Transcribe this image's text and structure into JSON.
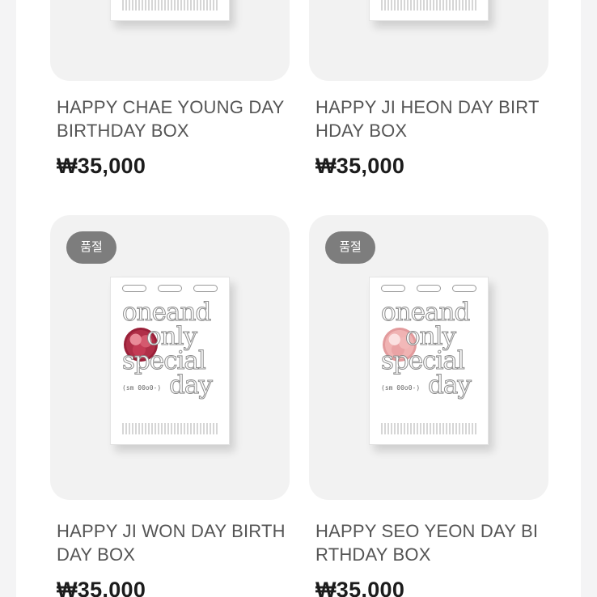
{
  "products": [
    {
      "title": "HAPPY CHAE YOUNG DAY BIRTHDAY BOX",
      "price": "₩35,000",
      "badge": ""
    },
    {
      "title": "HAPPY JI HEON DAY BIRTHDAY BOX",
      "price": "₩35,000",
      "badge": ""
    },
    {
      "title": "HAPPY JI WON DAY BIRTHDAY BOX",
      "price": "₩35,000",
      "badge": "품절",
      "flower_color": "#b02f48",
      "box_text": [
        "oneand",
        "only",
        "special",
        "day"
      ],
      "box_tag": "(sm 00o0-)"
    },
    {
      "title": "HAPPY SEO YEON DAY BIRTHDAY BOX",
      "price": "₩35,000",
      "badge": "품절",
      "flower_color": "#f0b3b3",
      "box_text": [
        "oneand",
        "only",
        "special",
        "day"
      ],
      "box_tag": "(sm 00o0-)"
    }
  ],
  "colors": {
    "badge_bg": "#7d7d7d",
    "thumb_bg": "#f2f2f2",
    "price_text": "#1c1c1c",
    "title_text": "#555555"
  }
}
